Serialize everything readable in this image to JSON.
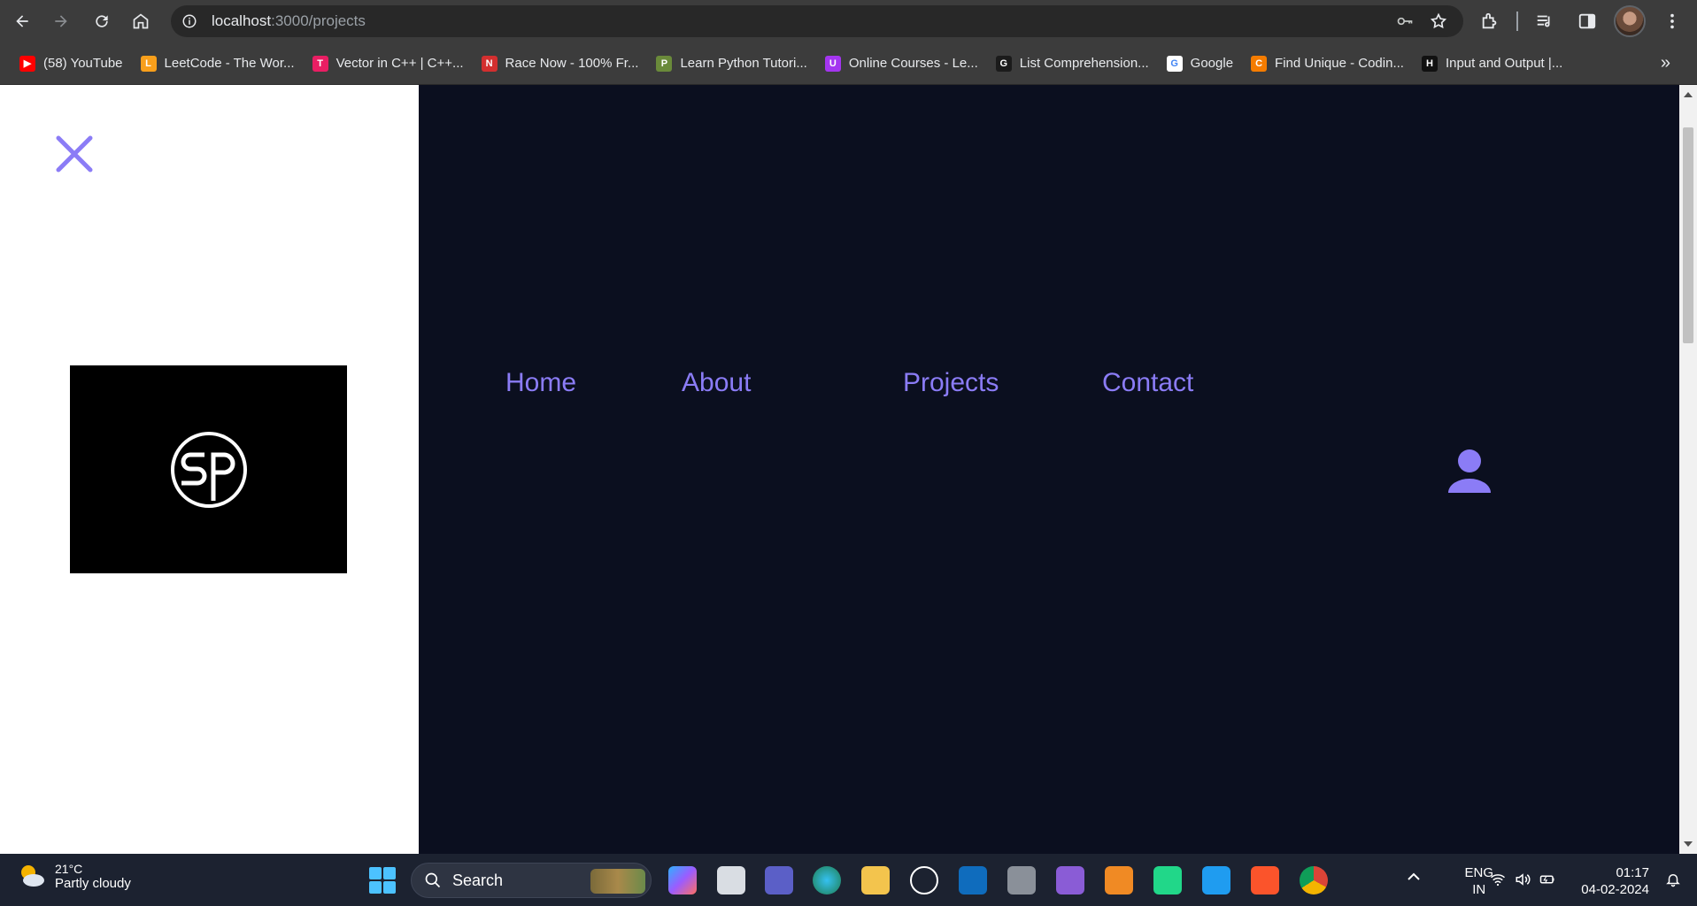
{
  "browser": {
    "url_host": "localhost",
    "url_path": ":3000/projects"
  },
  "bookmarks": [
    {
      "label": "(58) YouTube",
      "icon": "youtube-icon",
      "color": "#ff0000",
      "glyph": "▶"
    },
    {
      "label": "LeetCode - The Wor...",
      "icon": "leetcode-icon",
      "color": "#f89f1b",
      "glyph": "L"
    },
    {
      "label": "Vector in C++ | C++...",
      "icon": "tpoint-icon",
      "color": "#e91e63",
      "glyph": "T"
    },
    {
      "label": "Race Now - 100% Fr...",
      "icon": "race-icon",
      "color": "#d32f2f",
      "glyph": "N"
    },
    {
      "label": "Learn Python Tutori...",
      "icon": "python-icon",
      "color": "#6a8a3a",
      "glyph": "P"
    },
    {
      "label": "Online Courses - Le...",
      "icon": "udemy-icon",
      "color": "#a435f0",
      "glyph": "U"
    },
    {
      "label": "List Comprehension...",
      "icon": "gfg-icon",
      "color": "#1b1b1b",
      "glyph": "G"
    },
    {
      "label": "Google",
      "icon": "google-icon",
      "color": "#ffffff",
      "glyph": "G"
    },
    {
      "label": "Find Unique - Codin...",
      "icon": "codingninjas-icon",
      "color": "#f57c00",
      "glyph": "C"
    },
    {
      "label": "Input and Output |...",
      "icon": "hackerrank-icon",
      "color": "#111111",
      "glyph": "H"
    }
  ],
  "page": {
    "nav": [
      {
        "label": "Home",
        "id": "home"
      },
      {
        "label": "About",
        "id": "about"
      },
      {
        "label": "Projects",
        "id": "projects"
      },
      {
        "label": "Contact",
        "id": "contact"
      }
    ],
    "logo_text": "SP",
    "accent": "#8b7cf6",
    "background": "#0b0f1f"
  },
  "taskbar": {
    "temperature": "21°C",
    "weather": "Partly cloudy",
    "search_placeholder": "Search",
    "lang_line1": "ENG",
    "lang_line2": "IN",
    "time": "01:17",
    "date": "04-02-2024"
  }
}
